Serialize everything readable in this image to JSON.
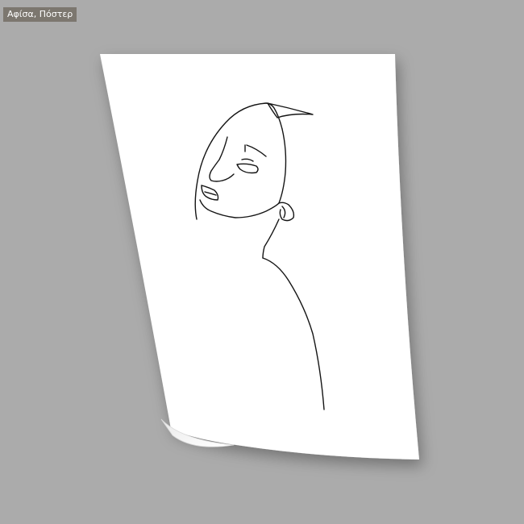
{
  "product": {
    "category_label": "Αφίσα, Πόστερ"
  },
  "colors": {
    "background": "#ababab",
    "poster": "#ffffff",
    "line": "#141414",
    "badge_bg": "#7c776f",
    "badge_text": "#ffffff"
  }
}
